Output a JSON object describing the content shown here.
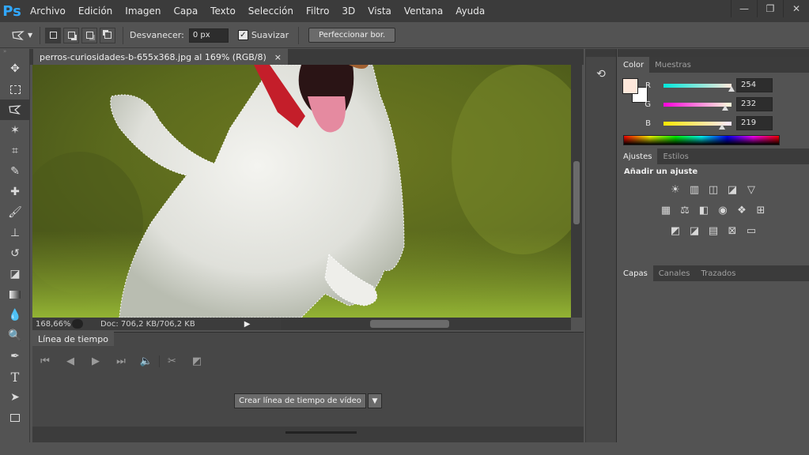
{
  "app": {
    "logo": "Ps"
  },
  "menu": [
    "Archivo",
    "Edición",
    "Imagen",
    "Capa",
    "Texto",
    "Selección",
    "Filtro",
    "3D",
    "Vista",
    "Ventana",
    "Ayuda"
  ],
  "window_controls": [
    "minimize-icon",
    "restore-icon",
    "close-icon"
  ],
  "options": {
    "feather_label": "Desvanecer:",
    "feather_value": "0 px",
    "smooth_label": "Suavizar",
    "smooth_checked": true,
    "refine_button": "Perfeccionar bor."
  },
  "document": {
    "tab_title": "perros-curiosidades-b-655x368.jpg al 169% (RGB/8)",
    "close_glyph": "×"
  },
  "status": {
    "zoom": "168,66%",
    "doc": "Doc: 706,2 KB/706,2 KB"
  },
  "timeline": {
    "tab_label": "Línea de tiempo",
    "create_button": "Crear línea de tiempo de vídeo"
  },
  "color_panel": {
    "tabs": [
      "Color",
      "Muestras"
    ],
    "foreground_color": "#fee8db",
    "background_color": "#ffffff",
    "channels": [
      {
        "label": "R",
        "value": "254",
        "level": 0.996,
        "gradient": "linear-gradient(90deg,#00e8db,#fee8db)"
      },
      {
        "label": "G",
        "value": "232",
        "level": 0.91,
        "gradient": "linear-gradient(90deg,#fe00db,#feffdb)"
      },
      {
        "label": "B",
        "value": "219",
        "level": 0.859,
        "gradient": "linear-gradient(90deg,#fee800,#fee8ff)"
      }
    ]
  },
  "adjust_panel": {
    "tabs": [
      "Ajustes",
      "Estilos"
    ],
    "heading": "Añadir un ajuste"
  },
  "layers_panel": {
    "tabs": [
      "Capas",
      "Canales",
      "Trazados"
    ]
  },
  "colors": {
    "ps_blue": "#31a8ff",
    "panel": "#535353",
    "dark": "#3b3b3b"
  }
}
